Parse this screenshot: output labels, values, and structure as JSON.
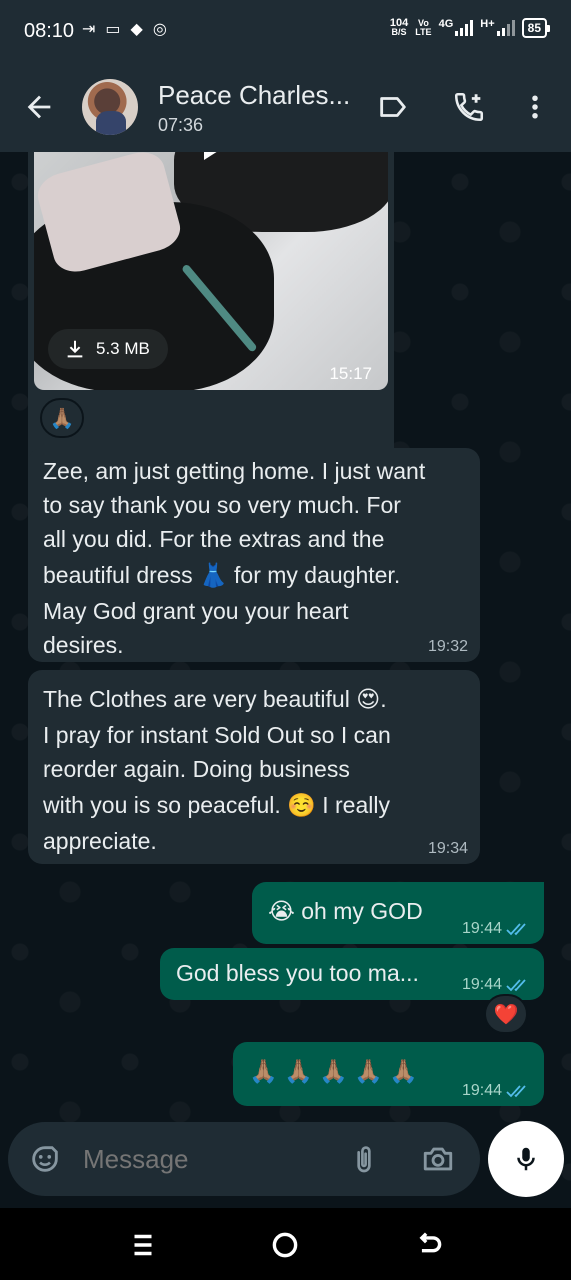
{
  "status_bar": {
    "time": "08:10",
    "net_speed": "104",
    "net_unit": "B/S",
    "volte_top": "Vo",
    "volte_bottom": "LTE",
    "gen1": "4G",
    "gen2": "H+",
    "battery": "85"
  },
  "header": {
    "contact_name": "Peace Charles...",
    "subtitle": "07:36"
  },
  "messages": {
    "video": {
      "size": "5.3 MB",
      "time": "15:17",
      "reaction": "🙏🏽"
    },
    "m1": {
      "lines": [
        "Zee, am just getting home. I just want",
        "to say thank you so very much. For",
        "all you did. For the extras and the",
        "beautiful dress 👗 for my daughter.",
        "May God grant you your heart",
        "desires."
      ],
      "time": "19:32"
    },
    "m2": {
      "lines": [
        "The Clothes are very beautiful 😍.",
        "I pray for instant Sold Out so I can",
        "reorder again. Doing business",
        "with you is so peaceful. ☺️ I really",
        "appreciate."
      ],
      "time": "19:34"
    },
    "m3": {
      "text": "😭 oh my GOD",
      "time": "19:44"
    },
    "m4": {
      "text": "God bless you too ma...",
      "time": "19:44",
      "reaction": "❤️"
    },
    "m5": {
      "text": "🙏🏽 🙏🏽 🙏🏽 🙏🏽 🙏🏽",
      "time": "19:44"
    }
  },
  "input": {
    "placeholder": "Message"
  },
  "colors": {
    "background": "#0b141a",
    "header": "#1f2c34",
    "incoming_bubble": "#202c33",
    "outgoing_bubble": "#005c4b",
    "read_ticks": "#53bdeb"
  }
}
